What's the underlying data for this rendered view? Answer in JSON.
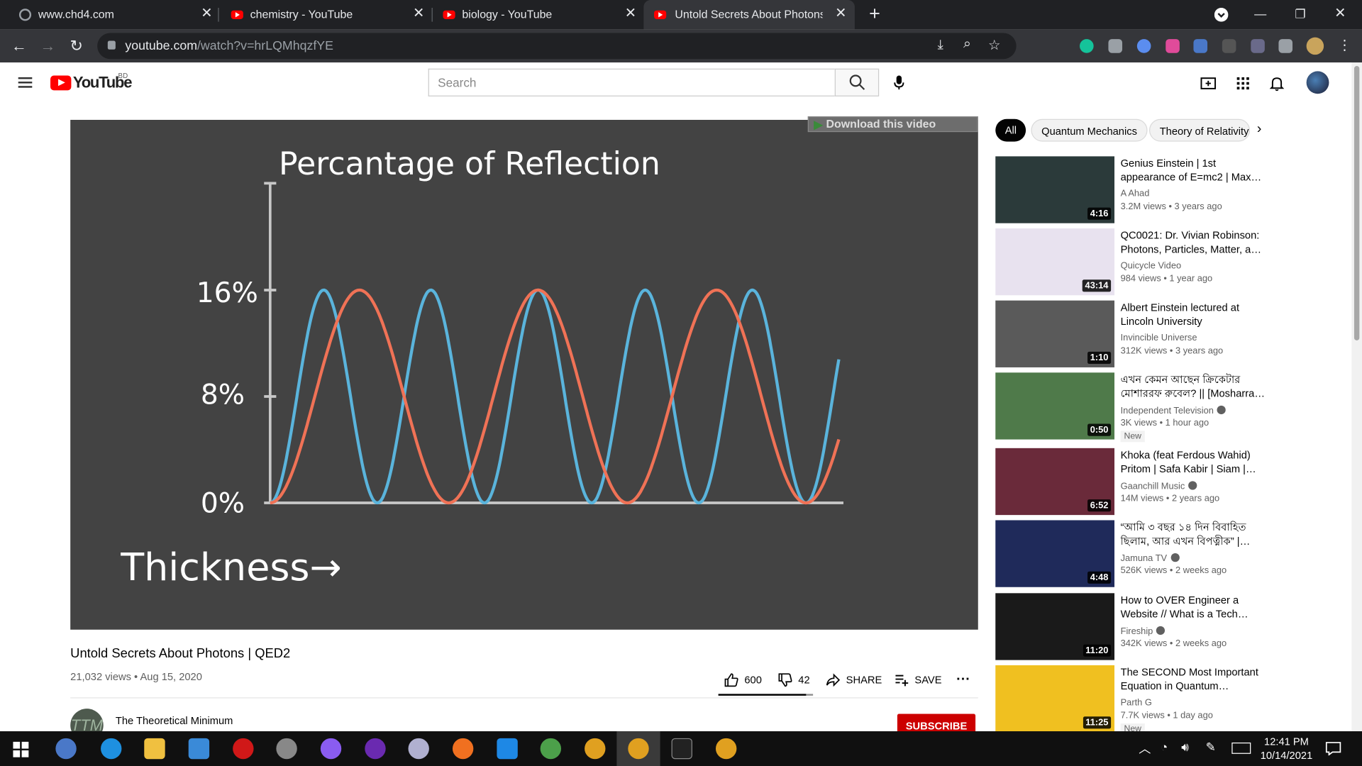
{
  "browser": {
    "tabs": [
      {
        "label": "www.chd4.com",
        "icon": "globe-icon"
      },
      {
        "label": "chemistry - YouTube",
        "icon": "youtube-icon"
      },
      {
        "label": "biology - YouTube",
        "icon": "youtube-icon"
      },
      {
        "label": "Untold Secrets About Photons | QED2",
        "icon": "youtube-icon",
        "active": true
      }
    ],
    "url_host": "youtube.com",
    "url_path": "/watch?v=hrLQMhqzfYE"
  },
  "youtube": {
    "logo_text": "YouTube",
    "country": "BD",
    "search_placeholder": "Search"
  },
  "video": {
    "download_label": "Download this video",
    "title": "Untold Secrets About Photons | QED2",
    "views": "21,032 views",
    "date": "Aug 15, 2020",
    "likes": "600",
    "dislikes": "42",
    "like_ratio": 0.93,
    "share_label": "SHARE",
    "save_label": "SAVE",
    "channel": "The Theoretical Minimum",
    "channel_initials": "TTM",
    "subscribe_label": "SUBSCRIBE"
  },
  "chart_data": {
    "type": "line",
    "title": "Percantage of Reflection",
    "xlabel": "Thickness→",
    "ylabel": "",
    "y_ticks": [
      "0%",
      "8%",
      "16%"
    ],
    "ylim": [
      0,
      16
    ],
    "series": [
      {
        "color": "#5ab4dc",
        "period": 0.1875,
        "amplitude": 16
      },
      {
        "color": "#f07256",
        "period": 0.3125,
        "amplitude": 16
      }
    ],
    "x_range": [
      0,
      1
    ]
  },
  "chips": [
    "All",
    "Quantum Mechanics",
    "Theory of Relativity"
  ],
  "recommendations": [
    {
      "title": "Genius Einstein | 1st appearance of E=mc2 | Max Planck",
      "channel": "A Ahad",
      "meta": "3.2M views • 3 years ago",
      "duration": "4:16",
      "thumb": "#2b3a3a"
    },
    {
      "title": "QC0021: Dr. Vivian Robinson: Photons, Particles, Matter, and Light",
      "channel": "Quicycle Video",
      "meta": "984 views • 1 year ago",
      "duration": "43:14",
      "thumb": "#e8e2ef"
    },
    {
      "title": "Albert Einstein lectured at Lincoln University",
      "channel": "Invincible Universe",
      "meta": "312K views • 3 years ago",
      "duration": "1:10",
      "thumb": "#5a5a5a"
    },
    {
      "title": "এখন কেমন আছেন ক্রিকেটার মোশাররফ রুবেল? || [Mosharraf Rubel]",
      "channel": "Independent Television",
      "verified": true,
      "meta": "3K views • 1 hour ago",
      "new": "New",
      "duration": "0:50",
      "thumb": "#4f7a4a"
    },
    {
      "title": "Khoka (feat Ferdous Wahid) Pritom | Safa Kabir | Siam | Pritom Hasan",
      "channel": "Gaanchill Music",
      "verified": true,
      "meta": "14M views • 2 years ago",
      "duration": "6:52",
      "thumb": "#6a2a3a"
    },
    {
      "title": "“আমি ৩ বছর ১৪ দিন বিবাহিত ছিলাম, আর এখন বিপত্নীক” | Jamuna TV",
      "channel": "Jamuna TV",
      "verified": true,
      "meta": "526K views • 2 weeks ago",
      "duration": "4:48",
      "thumb": "#1f2a5a"
    },
    {
      "title": "How to OVER Engineer a Website // What is a Tech Stack?",
      "channel": "Fireship",
      "verified": true,
      "meta": "342K views • 2 weeks ago",
      "duration": "11:20",
      "thumb": "#1a1a1a"
    },
    {
      "title": "The SECOND Most Important Equation in Quantum Mechanics",
      "channel": "Parth G",
      "meta": "7.7K views • 1 day ago",
      "new": "New",
      "duration": "11:25",
      "thumb": "#f0c020"
    }
  ],
  "taskbar": {
    "time": "12:41 PM",
    "date": "10/14/2021"
  }
}
